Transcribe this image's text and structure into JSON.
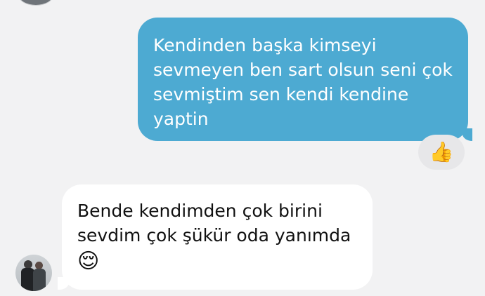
{
  "conversation": {
    "outgoing_message": {
      "text": "Kendinden başka kimseyi\nsevmeyen ben sart olsun seni çok\nsevmiştim sen kendi kendine\nyaptin"
    },
    "reaction": {
      "emoji": "👍"
    },
    "incoming_message": {
      "text": "Bende kendimden çok birini\nsevdim çok şükür oda yanımda",
      "emoji": "😌"
    }
  },
  "colors": {
    "background": "#f2f2f3",
    "outgoing_bubble": "#4daad2",
    "incoming_bubble": "#ffffff",
    "reaction_pill": "#e7e7e9"
  },
  "icons": {
    "top_avatar": "avatar-icon",
    "bottom_avatar": "avatar-icon"
  }
}
